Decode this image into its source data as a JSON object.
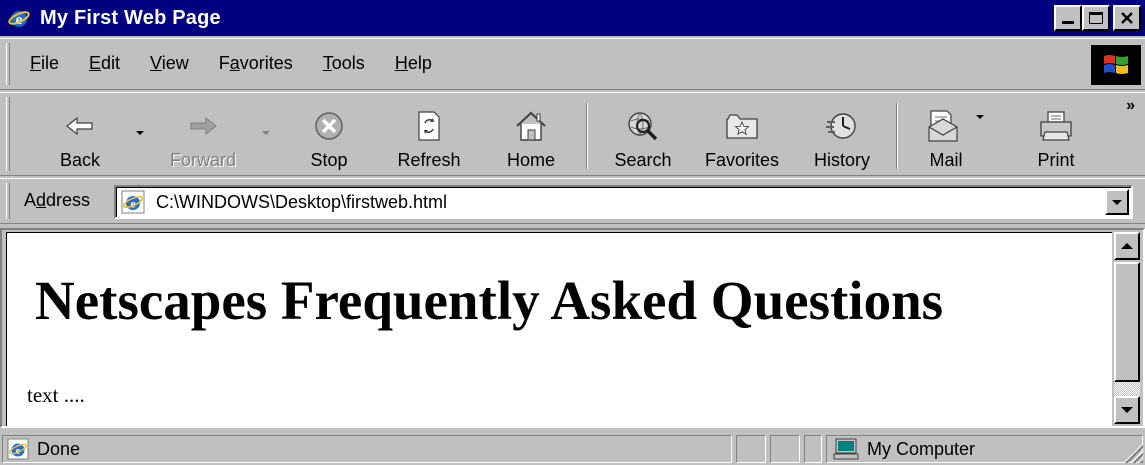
{
  "window": {
    "title": "My First Web Page",
    "controls": {
      "minimize_icon": "minimize-icon",
      "maximize_icon": "maximize-icon",
      "close_icon": "close-icon"
    }
  },
  "menu": {
    "items": [
      {
        "label": "File",
        "accel": "F",
        "rest": "ile"
      },
      {
        "label": "Edit",
        "accel": "E",
        "rest": "dit"
      },
      {
        "label": "View",
        "accel": "V",
        "rest": "iew"
      },
      {
        "label": "Favorites",
        "pre": "F",
        "accel": "a",
        "rest": "vorites"
      },
      {
        "label": "Tools",
        "accel": "T",
        "rest": "ools"
      },
      {
        "label": "Help",
        "accel": "H",
        "rest": "elp"
      }
    ]
  },
  "toolbar": {
    "back": {
      "label": "Back",
      "icon": "back-arrow-icon"
    },
    "forward": {
      "label": "Forward",
      "icon": "forward-arrow-icon",
      "enabled": false
    },
    "stop": {
      "label": "Stop",
      "icon": "stop-icon"
    },
    "refresh": {
      "label": "Refresh",
      "icon": "refresh-icon"
    },
    "home": {
      "label": "Home",
      "icon": "home-icon"
    },
    "search": {
      "label": "Search",
      "icon": "search-globe-icon"
    },
    "favorites": {
      "label": "Favorites",
      "icon": "favorites-folder-icon"
    },
    "history": {
      "label": "History",
      "icon": "history-icon"
    },
    "mail": {
      "label": "Mail",
      "icon": "mail-icon"
    },
    "print": {
      "label": "Print",
      "icon": "printer-icon"
    },
    "more": "»"
  },
  "address": {
    "label": "Address",
    "label_pre": "A",
    "label_accel": "d",
    "label_rest": "dress",
    "value": "C:\\WINDOWS\\Desktop\\firstweb.html"
  },
  "page": {
    "heading": "Netscapes Frequently Asked Questions",
    "body_text": "text ...."
  },
  "status": {
    "text": "Done",
    "zone": "My Computer"
  },
  "colors": {
    "title_bar": "#000080",
    "chrome": "#c0c0c0",
    "page_bg": "#ffffff"
  }
}
